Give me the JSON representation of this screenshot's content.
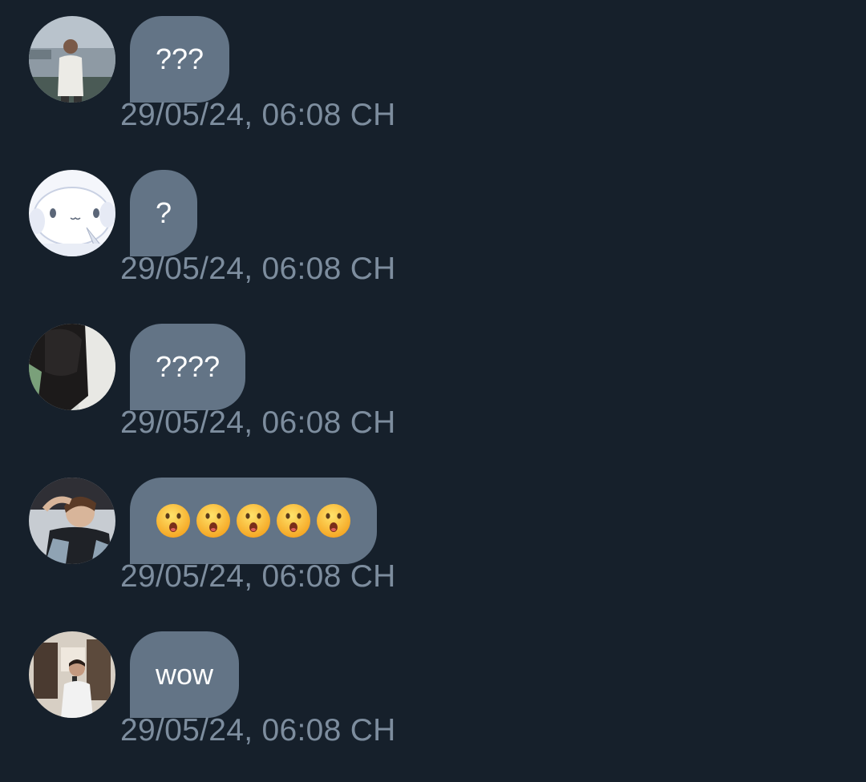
{
  "colors": {
    "background": "#16202b",
    "bubble": "#637486",
    "bubble_text": "#ffffff",
    "timestamp": "#7d8d9e"
  },
  "messages": [
    {
      "avatar": "user-photo-avatar",
      "text": "???",
      "timestamp": "29/05/24, 06:08 CH"
    },
    {
      "avatar": "cartoon-character-avatar",
      "text": "?",
      "timestamp": "29/05/24, 06:08 CH"
    },
    {
      "avatar": "user-photo-avatar",
      "text": "????",
      "timestamp": "29/05/24, 06:08 CH"
    },
    {
      "avatar": "user-photo-avatar",
      "emoji_name": "hushed-face-emoji",
      "emoji_count": 5,
      "text": "😮😮😮😮😮",
      "timestamp": "29/05/24, 06:08 CH"
    },
    {
      "avatar": "user-photo-avatar",
      "text": "wow",
      "timestamp": "29/05/24, 06:08 CH"
    }
  ]
}
